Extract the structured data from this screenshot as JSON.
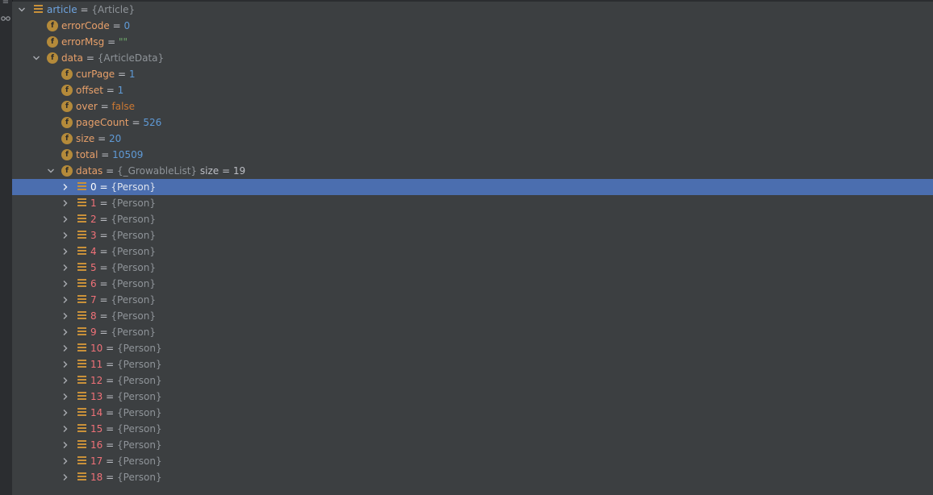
{
  "gutter": {
    "icons": [
      "list-icon",
      "glasses-icon"
    ]
  },
  "tree": {
    "root": {
      "name": "article",
      "eq": "=",
      "type": "{Article}"
    },
    "fields": [
      {
        "name": "errorCode",
        "eq": "=",
        "value": "0",
        "kind": "num"
      },
      {
        "name": "errorMsg",
        "eq": "=",
        "value": "\"\"",
        "kind": "str"
      }
    ],
    "data": {
      "name": "data",
      "eq": "=",
      "type": "{ArticleData}"
    },
    "data_fields": [
      {
        "name": "curPage",
        "eq": "=",
        "value": "1",
        "kind": "num"
      },
      {
        "name": "offset",
        "eq": "=",
        "value": "1",
        "kind": "num"
      },
      {
        "name": "over",
        "eq": "=",
        "value": "false",
        "kind": "kw"
      },
      {
        "name": "pageCount",
        "eq": "=",
        "value": "526",
        "kind": "num"
      },
      {
        "name": "size",
        "eq": "=",
        "value": "20",
        "kind": "num"
      },
      {
        "name": "total",
        "eq": "=",
        "value": "10509",
        "kind": "num"
      }
    ],
    "datas": {
      "name": "datas",
      "eq": "=",
      "type": "{_GrowableList}",
      "extra": "size = 19"
    },
    "items": [
      {
        "index": "0",
        "eq": "=",
        "type": "{Person}",
        "selected": true
      },
      {
        "index": "1",
        "eq": "=",
        "type": "{Person}"
      },
      {
        "index": "2",
        "eq": "=",
        "type": "{Person}"
      },
      {
        "index": "3",
        "eq": "=",
        "type": "{Person}"
      },
      {
        "index": "4",
        "eq": "=",
        "type": "{Person}"
      },
      {
        "index": "5",
        "eq": "=",
        "type": "{Person}"
      },
      {
        "index": "6",
        "eq": "=",
        "type": "{Person}"
      },
      {
        "index": "7",
        "eq": "=",
        "type": "{Person}"
      },
      {
        "index": "8",
        "eq": "=",
        "type": "{Person}"
      },
      {
        "index": "9",
        "eq": "=",
        "type": "{Person}"
      },
      {
        "index": "10",
        "eq": "=",
        "type": "{Person}"
      },
      {
        "index": "11",
        "eq": "=",
        "type": "{Person}"
      },
      {
        "index": "12",
        "eq": "=",
        "type": "{Person}"
      },
      {
        "index": "13",
        "eq": "=",
        "type": "{Person}"
      },
      {
        "index": "14",
        "eq": "=",
        "type": "{Person}"
      },
      {
        "index": "15",
        "eq": "=",
        "type": "{Person}"
      },
      {
        "index": "16",
        "eq": "=",
        "type": "{Person}"
      },
      {
        "index": "17",
        "eq": "=",
        "type": "{Person}"
      },
      {
        "index": "18",
        "eq": "=",
        "type": "{Person}"
      }
    ]
  },
  "colors": {
    "background": "#3c3f41",
    "selection": "#4b6eaf",
    "field_icon": "#b48a3a",
    "array_icon": "#c9913a"
  }
}
